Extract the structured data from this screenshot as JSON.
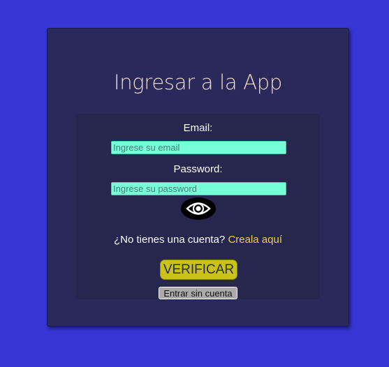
{
  "login": {
    "title": "Ingresar a la App",
    "email_label": "Email:",
    "email_placeholder": "Ingrese su email",
    "password_label": "Password:",
    "password_placeholder": "Ingrese su password",
    "toggle_password_icon": "eye-icon",
    "signup_prompt": "¿No tienes una cuenta?",
    "signup_link": "Creala aquí",
    "verify_button": "VERIFICAR",
    "guest_button": "Entrar sin cuenta"
  },
  "colors": {
    "page_background": "#3536d4",
    "card_background": "#29295a",
    "panel_background": "#26264f",
    "input_background": "#77ffd8",
    "title_text": "#f3d9cc",
    "link": "#f2cf3a",
    "verify_button": "#c9c21b",
    "guest_button": "#aaaaaa"
  }
}
